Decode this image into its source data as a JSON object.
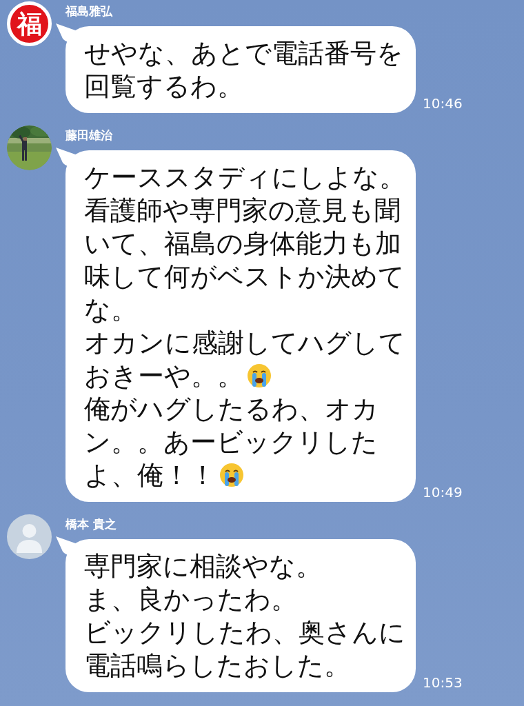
{
  "messages": [
    {
      "sender": "福島雅弘",
      "avatar": {
        "kind": "logo",
        "text": "福"
      },
      "lines": [
        {
          "text": "せやな、あとで電話番号を",
          "emoji": false
        },
        {
          "text": "回覧するわ。",
          "emoji": false
        }
      ],
      "time": "10:46"
    },
    {
      "sender": "藤田雄治",
      "lines": [
        {
          "text": "ケーススタディにしよな。",
          "emoji": false
        },
        {
          "text": "看護師や専門家の意見も聞",
          "emoji": false
        },
        {
          "text": "いて、福島の身体能力も加",
          "emoji": false
        },
        {
          "text": "味して何がベストか決めて",
          "emoji": false
        },
        {
          "text": "な。",
          "emoji": false
        },
        {
          "text": "オカンに感謝してハグして",
          "emoji": false
        },
        {
          "text": "おきーや。。",
          "emoji": true
        },
        {
          "text": "俺がハグしたるわ、オカ",
          "emoji": false
        },
        {
          "text": "ン。。あービックリした",
          "emoji": false
        },
        {
          "text": "よ、俺！！",
          "emoji": true
        }
      ],
      "time": "10:49"
    },
    {
      "sender": "橋本 貴之",
      "avatar": {
        "kind": "default"
      },
      "lines": [
        {
          "text": "専門家に相談やな。",
          "emoji": false
        },
        {
          "text": "ま、良かったわ。",
          "emoji": false
        },
        {
          "text": "ビックリしたわ、奥さんに",
          "emoji": false
        },
        {
          "text": "電話鳴らしたおした。",
          "emoji": false
        }
      ],
      "time": "10:53"
    }
  ]
}
